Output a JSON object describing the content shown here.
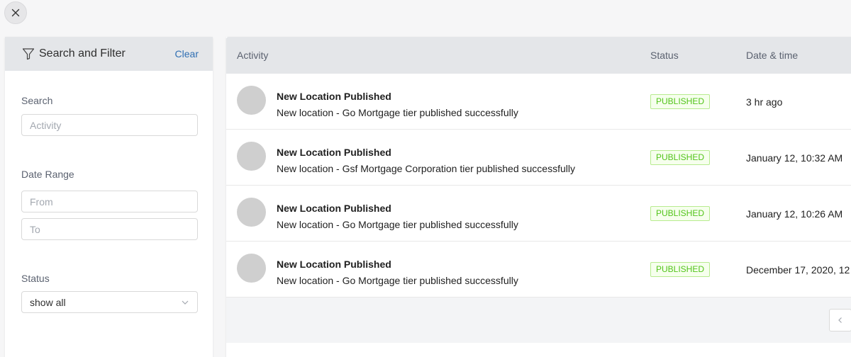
{
  "sidebar": {
    "title": "Search and Filter",
    "clear_label": "Clear",
    "search": {
      "label": "Search",
      "placeholder": "Activity",
      "value": ""
    },
    "date_range": {
      "label": "Date Range",
      "from_placeholder": "From",
      "to_placeholder": "To"
    },
    "status": {
      "label": "Status",
      "selected": "show all"
    }
  },
  "table": {
    "columns": {
      "activity": "Activity",
      "status": "Status",
      "datetime": "Date & time"
    },
    "rows": [
      {
        "title": "New Location Published",
        "description": "New location - Go Mortgage tier published successfully",
        "status": "PUBLISHED",
        "datetime": "3 hr ago"
      },
      {
        "title": "New Location Published",
        "description": "New location - Gsf Mortgage Corporation tier published successfully",
        "status": "PUBLISHED",
        "datetime": "January 12, 10:32 AM"
      },
      {
        "title": "New Location Published",
        "description": "New location - Go Mortgage tier published successfully",
        "status": "PUBLISHED",
        "datetime": "January 12, 10:26 AM"
      },
      {
        "title": "New Location Published",
        "description": "New location - Go Mortgage tier published successfully",
        "status": "PUBLISHED",
        "datetime": "December 17, 2020, 12"
      }
    ]
  },
  "icons": {
    "close": "close-icon",
    "filter": "filter-icon",
    "dropdown": "chevron-down-icon",
    "prev_page": "chevron-left-icon"
  },
  "colors": {
    "accent_link": "#2f6fb3",
    "badge_text": "#52c41a",
    "badge_border": "#b7eb8f",
    "badge_bg": "#f6ffed",
    "header_bg": "#e4e6e9"
  }
}
